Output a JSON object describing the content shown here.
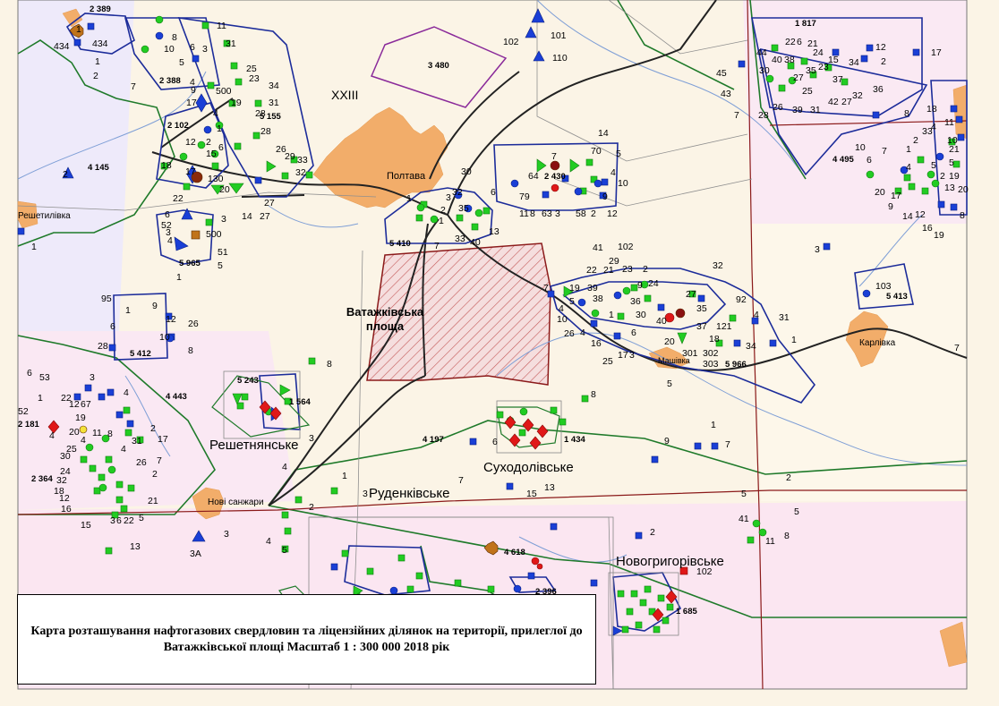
{
  "map": {
    "caption": "Карта розташування нафтогазових свердловин та ліцензійних ділянок на території, прилеглої до Ватажківської площі  Масштаб 1 : 300 000  2018 рік",
    "study_area_label": "Ватажківська площа",
    "towns": [
      "Полтава",
      "Карлівка",
      "Нові санжари",
      "Решетилівка",
      "Машівка"
    ],
    "zone_label": "XXIII",
    "fields": [
      "Решетнянське",
      "Суходолівське",
      "Руденківське",
      "Новогригорівське"
    ],
    "license_area_numbers": [
      "2 389",
      "2 388",
      "2 102",
      "5 155",
      "4 145",
      "5 965",
      "5 412",
      "4 443",
      "2 181",
      "2 364",
      "5 243",
      "1 564",
      "3 480",
      "1 817",
      "4 495",
      "5 410",
      "2 430",
      "5 966",
      "5 413",
      "4 197",
      "1 434",
      "4 618",
      "1 685",
      "2 396"
    ],
    "well_labels_sample": [
      "434",
      "102",
      "101",
      "110",
      "500",
      "130",
      "92",
      "301",
      "302",
      "303",
      "103",
      "3A"
    ],
    "legend_colors": {
      "license_boundary": "#1c2c9a",
      "field_boundary": "#1f7a2a",
      "study_area": "#8b1a1a",
      "road": "#222222",
      "town": "#f2ad6a",
      "well_green": "#22cc22",
      "well_blue": "#1a3fd6",
      "well_red": "#e01818",
      "well_brown": "#c0731a"
    }
  }
}
